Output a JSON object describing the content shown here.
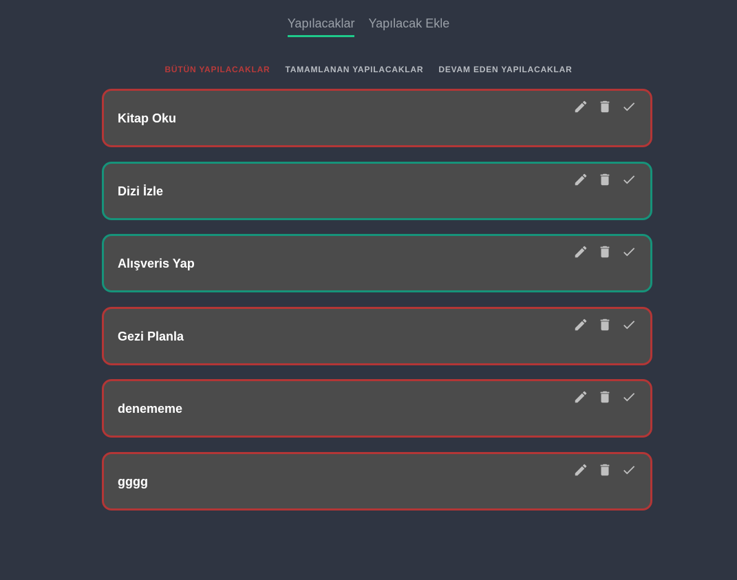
{
  "nav": {
    "tabs": [
      {
        "label": "Yapılacaklar",
        "active": true
      },
      {
        "label": "Yapılacak Ekle",
        "active": false
      }
    ]
  },
  "filters": [
    {
      "label": "BÜTÜN YAPILACAKLAR",
      "active": true
    },
    {
      "label": "TAMAMLANAN YAPILACAKLAR",
      "active": false
    },
    {
      "label": "DEVAM EDEN YAPILACAKLAR",
      "active": false
    }
  ],
  "todos": [
    {
      "title": "Kitap Oku",
      "completed": false
    },
    {
      "title": "Dizi İzle",
      "completed": true
    },
    {
      "title": "Alışveris Yap",
      "completed": true
    },
    {
      "title": "Gezi Planla",
      "completed": false
    },
    {
      "title": "denememe",
      "completed": false
    },
    {
      "title": "gggg",
      "completed": false
    }
  ],
  "colors": {
    "background": "#2f3542",
    "card": "#4b4b4b",
    "pending_border": "#b33636",
    "completed_border": "#16937a",
    "active_tab": "#1fc98a",
    "active_filter": "#b83a3a"
  },
  "icons": [
    "pencil-icon",
    "trash-icon",
    "check-icon"
  ]
}
